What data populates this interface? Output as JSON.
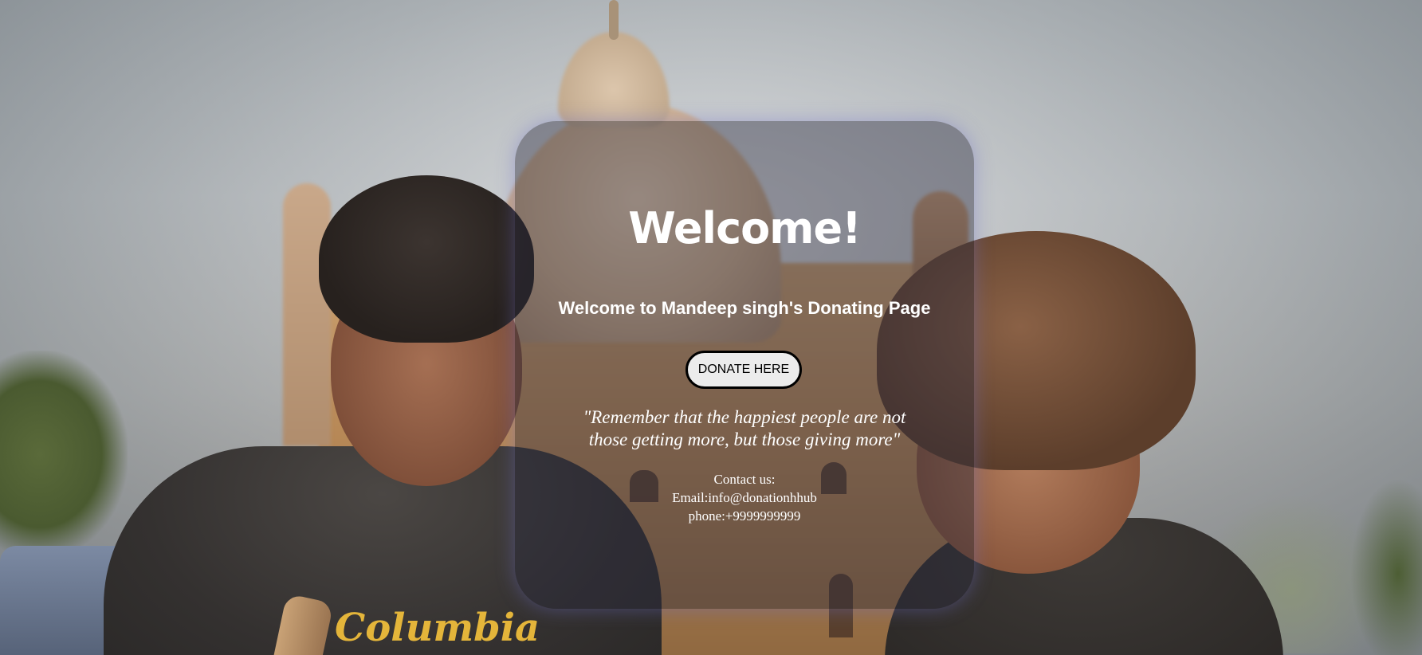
{
  "page": {
    "background_image_alt": "two children in front of a tomb"
  },
  "card": {
    "heading": "Welcome!",
    "subheading": "Welcome to Mandeep singh's Donating Page",
    "donate_button": "DONATE HERE",
    "quote_line1": "\"Remember that the happiest people are not",
    "quote_line2": "those getting more, but those giving more\"",
    "contact_title": "Contact us:",
    "contact_email": "Email:info@donationhhub",
    "contact_phone": "phone:+9999999999"
  },
  "colors": {
    "card_background": "#28283c",
    "text": "#ffffff",
    "button_background": "#ececec",
    "button_border": "#000000"
  }
}
